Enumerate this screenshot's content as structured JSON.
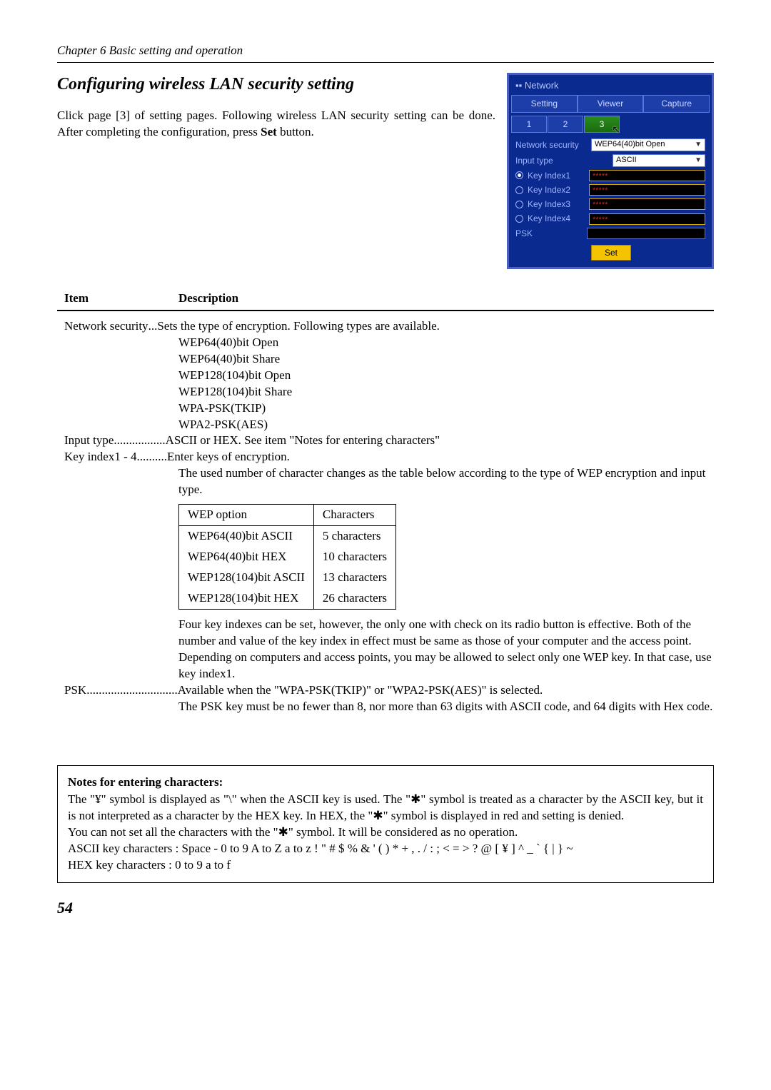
{
  "chapter_header": "Chapter 6 Basic setting and operation",
  "section_title": "Configuring wireless LAN security setting",
  "intro_p1": "Click page [3] of setting pages.  Following wireless LAN security setting can be done. After completing the configuration, press ",
  "intro_set": "Set",
  "intro_p2": " button.",
  "panel": {
    "title": "Network",
    "tabs": [
      "Setting",
      "Viewer",
      "Capture"
    ],
    "subtabs": [
      "1",
      "2",
      "3"
    ],
    "rows": {
      "network_security_label": "Network security",
      "network_security_value": "WEP64(40)bit Open",
      "input_type_label": "Input type",
      "input_type_value": "ASCII",
      "keys": [
        {
          "label": "Key Index1",
          "value": "*****",
          "selected": true
        },
        {
          "label": "Key Index2",
          "value": "*****",
          "selected": false
        },
        {
          "label": "Key Index3",
          "value": "*****",
          "selected": false
        },
        {
          "label": "Key Index4",
          "value": "*****",
          "selected": false
        }
      ],
      "psk_label": "PSK",
      "set_btn": "Set"
    }
  },
  "table_header": {
    "item": "Item",
    "desc": "Description"
  },
  "rows": {
    "ns_key": "Network security",
    "ns_dots": " ...",
    "ns_desc": "Sets the type of encryption. Following types are available.",
    "ns_types": [
      "WEP64(40)bit Open",
      "WEP64(40)bit Share",
      "WEP128(104)bit Open",
      "WEP128(104)bit Share",
      "WPA-PSK(TKIP)",
      "WPA2-PSK(AES)"
    ],
    "it_key": "Input type",
    "it_dots": ".................",
    "it_desc": "ASCII or HEX. See item \"Notes for entering characters\"",
    "ki_key": "Key index1 - 4",
    "ki_dots": "..........",
    "ki_desc": "Enter keys of encryption.",
    "ki_para": "The used number of character changes as the table below according to the type of WEP encryption and input type.",
    "wep_table": {
      "h1": "WEP option",
      "h2": "Characters",
      "r": [
        [
          "WEP64(40)bit ASCII",
          "5 characters"
        ],
        [
          "WEP64(40)bit HEX",
          "10 characters"
        ],
        [
          "WEP128(104)bit ASCII",
          "13 characters"
        ],
        [
          "WEP128(104)bit HEX",
          "26 characters"
        ]
      ]
    },
    "ki_after1": "Four key indexes can be set, however, the only one with check on its radio button is effective. Both of the number and value of the key index in effect must be same as those of your computer and the access point.",
    "ki_after2": "Depending on computers and access points, you may be allowed to select only one WEP key. In that case, use key index1.",
    "psk_key": "PSK",
    "psk_dots": "..............................",
    "psk_desc": "Available when the \"WPA-PSK(TKIP)\" or \"WPA2-PSK(AES)\" is selected.",
    "psk_para": "The PSK key must be no fewer than 8, nor more than 63 digits with ASCII code, and 64 digits with Hex code."
  },
  "notes": {
    "title": "Notes for entering characters:",
    "p1": "The \"¥\" symbol is displayed as \"\\\" when the ASCII key is used. The \"✱\" symbol is treated as a character by the ASCII key, but it is not interpreted as a character by the HEX key. In HEX, the \"✱\" symbol is displayed in red and setting is denied.",
    "p2": "You can not set all the characters with the \"✱\" symbol. It will be considered as no operation.",
    "p3": "ASCII key characters : Space - 0 to 9 A to Z a to z ! \" # $ % & ' ( ) * + , . / : ; < = > ? @ [ ¥ ] ^ _ ` { | } ~",
    "p4": "HEX key characters : 0 to 9 a to f"
  },
  "page_number": "54"
}
